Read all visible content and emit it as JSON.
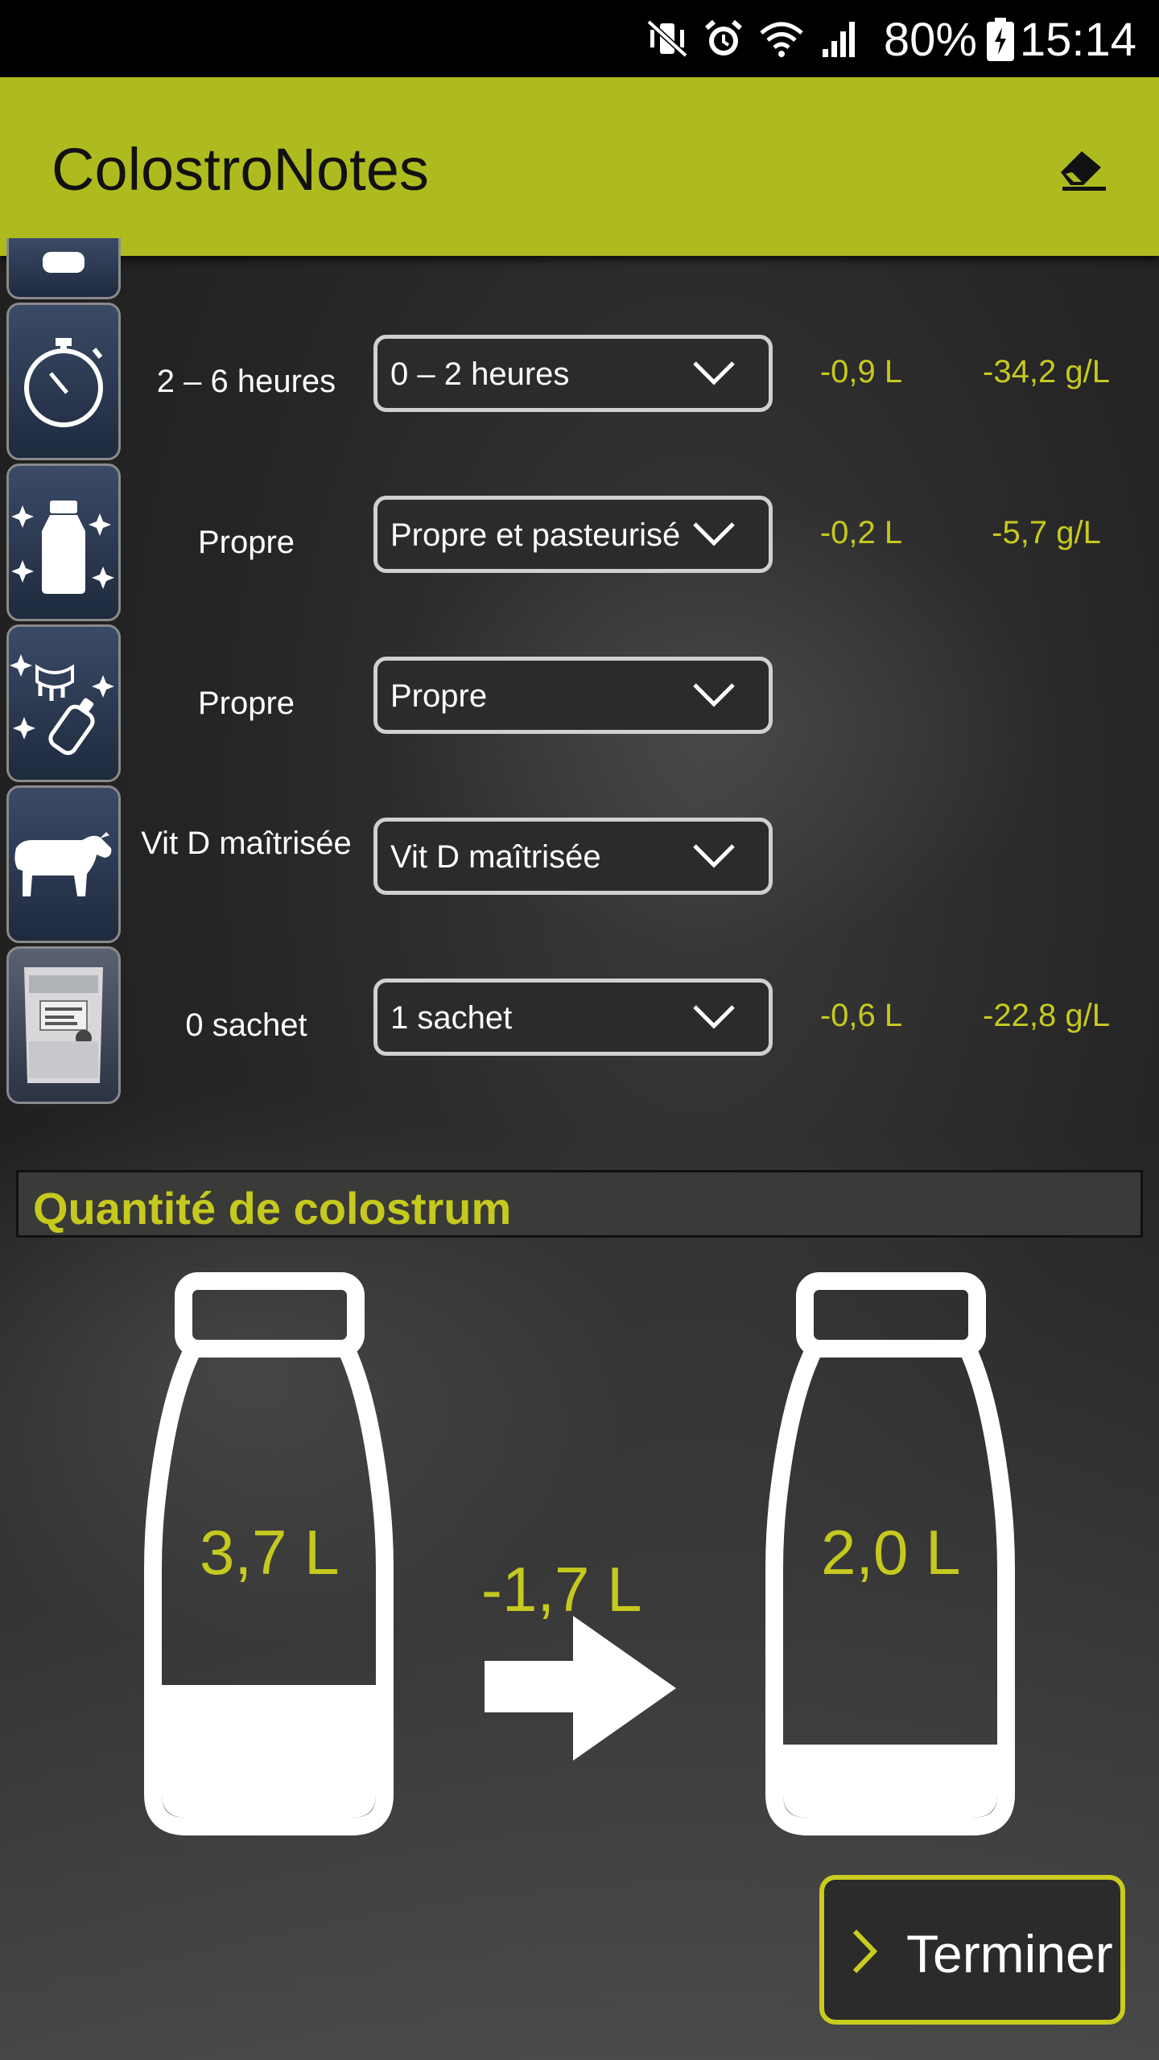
{
  "status_bar": {
    "battery": "80%",
    "time": "15:14"
  },
  "app_bar": {
    "title": "ColostroNotes",
    "clear_icon": "eraser-icon"
  },
  "rows": [
    {
      "icon": "stopwatch-icon",
      "current": "2 – 6 heures",
      "selected": "0 – 2 heures",
      "delta_l": "-0,9 L",
      "delta_g": "-34,2 g/L"
    },
    {
      "icon": "clean-bottle-icon",
      "current": "Propre",
      "selected": "Propre et pasteurisé",
      "delta_l": "-0,2 L",
      "delta_g": "-5,7 g/L"
    },
    {
      "icon": "clean-equipment-icon",
      "current": "Propre",
      "selected": "Propre",
      "delta_l": "",
      "delta_g": ""
    },
    {
      "icon": "cow-icon",
      "current": "Vit D maîtrisée",
      "selected": "Vit D maîtrisée",
      "delta_l": "",
      "delta_g": ""
    },
    {
      "icon": "sachet-icon",
      "current": "0 sachet",
      "selected": "1 sachet",
      "delta_l": "-0,6 L",
      "delta_g": "-22,8 g/L"
    }
  ],
  "quantity": {
    "title": "Quantité de colostrum",
    "before": "3,7 L",
    "delta": "-1,7 L",
    "after": "2,0 L"
  },
  "finish_button": {
    "label": "Terminer"
  },
  "colors": {
    "accent": "#aebb1f",
    "value_text": "#c6c91e"
  }
}
